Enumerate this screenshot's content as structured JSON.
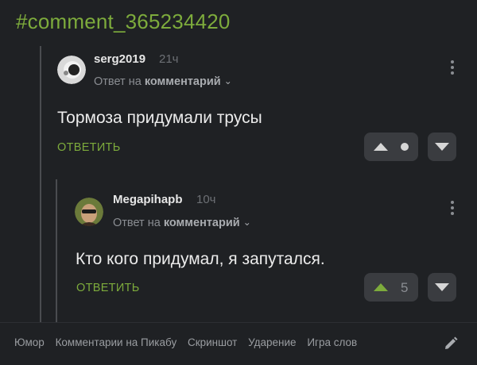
{
  "header": {
    "hashtag": "#comment_365234420"
  },
  "comments": [
    {
      "username": "serg2019",
      "time": "21ч",
      "reply_prefix": "Ответ на",
      "reply_target": "комментарий",
      "text": "Тормоза придумали трусы",
      "reply_label": "ОТВЕТИТЬ",
      "score": ""
    },
    {
      "username": "Megapihapb",
      "time": "10ч",
      "reply_prefix": "Ответ на",
      "reply_target": "комментарий",
      "text": "Кто кого придумал, я запутался.",
      "reply_label": "ОТВЕТИТЬ",
      "score": "5"
    }
  ],
  "tags": [
    "Юмор",
    "Комментарии на Пикабу",
    "Скриншот",
    "Ударение",
    "Игра слов"
  ],
  "colors": {
    "accent": "#7dab3c",
    "background": "#1f2124",
    "button": "#3a3c40"
  }
}
